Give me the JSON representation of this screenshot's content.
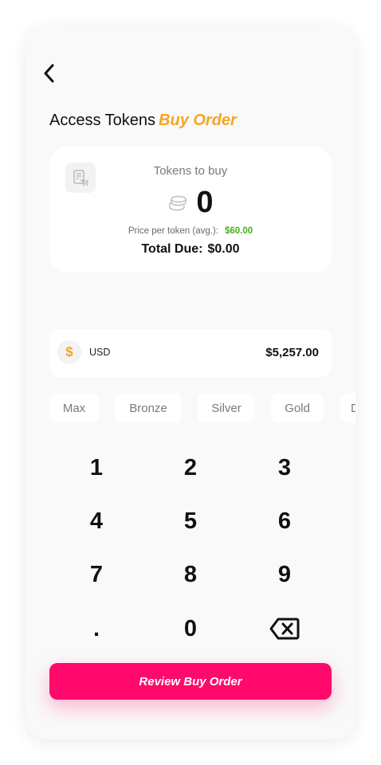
{
  "header": {
    "back_icon": "chevron-left-icon",
    "title_prefix": "Access Tokens",
    "title_accent": "Buy Order"
  },
  "token_card": {
    "icon": "receipt-cart-icon",
    "label": "Tokens to buy",
    "coins_icon": "coins-icon",
    "amount": "0",
    "price_label": "Price per token (avg.):",
    "price_value": "$60.00",
    "total_label": "Total Due:",
    "total_value": "$0.00"
  },
  "balance": {
    "currency_symbol": "$",
    "currency": "USD",
    "amount": "$5,257.00"
  },
  "chips": [
    "Max",
    "Bronze",
    "Silver",
    "Gold",
    "D"
  ],
  "keypad": [
    "1",
    "2",
    "3",
    "4",
    "5",
    "6",
    "7",
    "8",
    "9",
    ".",
    "0"
  ],
  "keypad_delete_icon": "backspace-icon",
  "review_button": "Review Buy Order",
  "colors": {
    "accent": "#f5a524",
    "primary": "#ff0a6c",
    "price_green": "#4caf1f"
  }
}
